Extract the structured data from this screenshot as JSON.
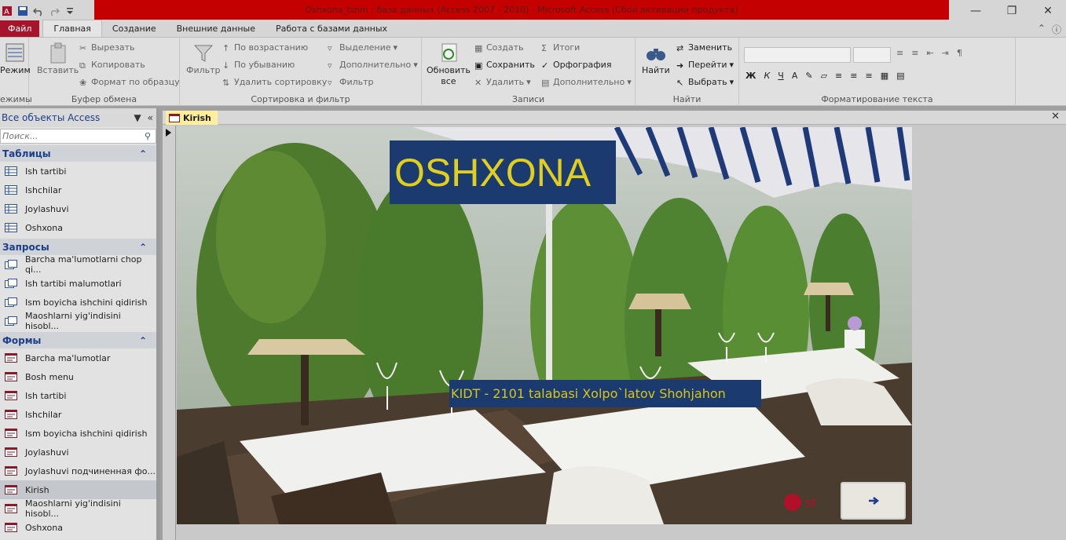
{
  "window": {
    "title": "Oshxona_tizim : база данных (Access 2007 - 2010)  -  Microsoft Access (Сбой активации продукта)",
    "accent": "#c40000"
  },
  "ribbon_tabs": [
    "Файл",
    "Главная",
    "Создание",
    "Внешние данные",
    "Работа с базами данных"
  ],
  "ribbon": {
    "views": {
      "mode": "Режим",
      "label": "ежимы"
    },
    "clipboard": {
      "paste": "Вставить",
      "cut": "Вырезать",
      "copy": "Копировать",
      "format_painter": "Формат по образцу",
      "label": "Буфер обмена"
    },
    "sort": {
      "filter": "Фильтр",
      "ascending": "По возрастанию",
      "descending": "По убыванию",
      "remove_sort": "Удалить сортировку",
      "selection": "Выделение",
      "advanced": "Дополнительно",
      "toggle_filter": "Фильтр",
      "label": "Сортировка и фильтр"
    },
    "records": {
      "refresh": "Обновить",
      "refresh_sub": "все",
      "new": "Создать",
      "save": "Сохранить",
      "delete": "Удалить",
      "totals": "Итоги",
      "spelling": "Орфография",
      "more": "Дополнительно",
      "label": "Записи"
    },
    "find": {
      "find": "Найти",
      "replace": "Заменить",
      "goto": "Перейти",
      "select": "Выбрать",
      "label": "Найти"
    },
    "text": {
      "bold": "Ж",
      "italic": "К",
      "underline": "Ч",
      "font_color": "А",
      "label": "Форматирование текста"
    }
  },
  "nav": {
    "header": "Все объекты Access",
    "search_placeholder": "Поиск...",
    "sections": [
      {
        "title": "Таблицы",
        "items": [
          "Ish tartibi",
          "Ishchilar",
          "Joylashuvi",
          "Oshxona"
        ]
      },
      {
        "title": "Запросы",
        "items": [
          "Barcha ma'lumotlarni chop qi...",
          "Ish tartibi malumotlari",
          "Ism boyicha ishchini qidirish",
          "Maoshlarni yig'indisini hisobl..."
        ]
      },
      {
        "title": "Формы",
        "items": [
          "Barcha ma'lumotlar",
          "Bosh menu",
          "Ish tartibi",
          "Ishchilar",
          "Ism boyicha ishchini qidirish",
          "Joylashuvi",
          "Joylashuvi подчиненная фо...",
          "Kirish",
          "Maoshlarni yig'indisini hisobl...",
          "Oshxona"
        ]
      }
    ],
    "selected_item": "Kirish"
  },
  "document": {
    "tab_label": "Kirish",
    "title": "OSHXONA",
    "subtitle": "KIDT - 2101 talabasi Xolpo`latov Shohjahon",
    "next_icon": "arrow-right-icon",
    "title_bg": "#1b3a70",
    "title_color": "#e0cf1f"
  }
}
